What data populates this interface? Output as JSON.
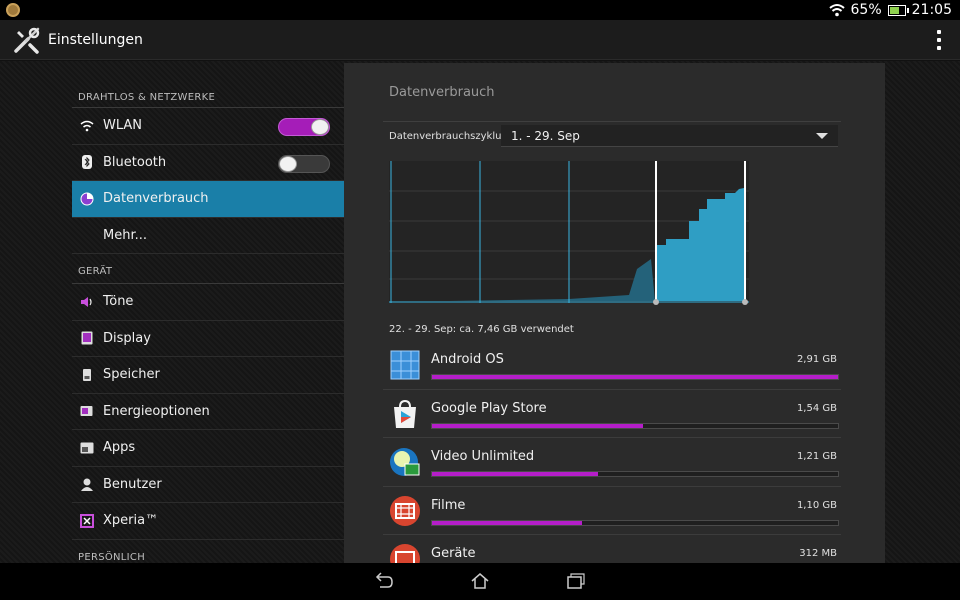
{
  "status_bar": {
    "battery_percent": "65%",
    "time": "21:05"
  },
  "action_bar": {
    "title": "Einstellungen"
  },
  "sidebar": {
    "sections": {
      "wireless": "DRAHTLOS & NETZWERKE",
      "device": "GERÄT",
      "personal": "PERSÖNLICH"
    },
    "items": {
      "wlan": {
        "label": "WLAN",
        "toggle_on": true
      },
      "bluetooth": {
        "label": "Bluetooth",
        "toggle_on": false
      },
      "data_usage": {
        "label": "Datenverbrauch",
        "active": true
      },
      "more": {
        "label": "Mehr..."
      },
      "sound": {
        "label": "Töne"
      },
      "display": {
        "label": "Display"
      },
      "storage": {
        "label": "Speicher"
      },
      "power": {
        "label": "Energieoptionen"
      },
      "apps": {
        "label": "Apps"
      },
      "users": {
        "label": "Benutzer"
      },
      "xperia": {
        "label": "Xperia™"
      }
    }
  },
  "panel": {
    "title": "Datenverbrauch",
    "cycle_label": "Datenverbrauchszyklus",
    "cycle_value": "1. - 29. Sep",
    "summary": "22. - 29. Sep: ca. 7,46 GB verwendet"
  },
  "apps": [
    {
      "name": "Android OS",
      "size": "2,91 GB",
      "fraction": 1.0
    },
    {
      "name": "Google Play Store",
      "size": "1,54 GB",
      "fraction": 0.52
    },
    {
      "name": "Video Unlimited",
      "size": "1,21 GB",
      "fraction": 0.41
    },
    {
      "name": "Filme",
      "size": "1,10 GB",
      "fraction": 0.37
    },
    {
      "name": "Geräte",
      "size": "312 MB",
      "fraction": 0.11
    }
  ],
  "colors": {
    "accent_purple": "#b51ec9",
    "active_blue": "#1a7fa8",
    "chart_fill": "#2f9ec4"
  }
}
